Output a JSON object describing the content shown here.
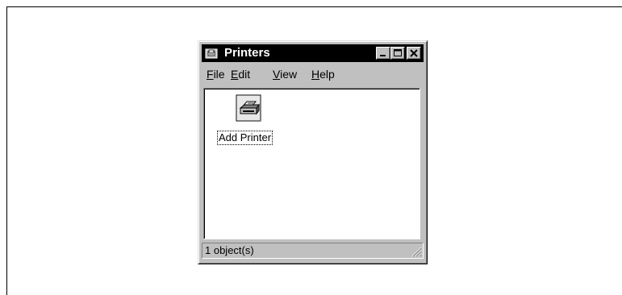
{
  "window": {
    "title": "Printers",
    "title_icon": "printers-folder-icon",
    "controls": [
      "minimize-icon",
      "maximize-icon",
      "close-icon"
    ]
  },
  "menubar": {
    "items": [
      {
        "mnemonic": "F",
        "rest": "ile"
      },
      {
        "mnemonic": "E",
        "rest": "dit"
      },
      {
        "mnemonic": "V",
        "rest": "iew"
      },
      {
        "mnemonic": "H",
        "rest": "elp"
      }
    ]
  },
  "content": {
    "items": [
      {
        "label": "Add Printer",
        "icon": "add-printer-icon"
      }
    ]
  },
  "statusbar": {
    "text": "1 object(s)"
  },
  "colors": {
    "titlebar_bg": "#000000",
    "window_bg": "#c0c0c0",
    "client_bg": "#ffffff"
  }
}
